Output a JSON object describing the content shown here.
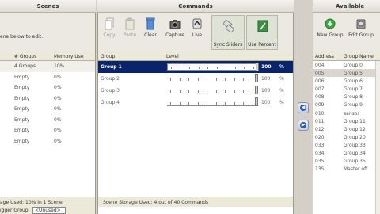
{
  "scenes": {
    "title": "Scenes",
    "hint": "ene below to edit.",
    "columns": [
      "# Groups",
      "Memory Use"
    ],
    "rows": [
      {
        "groups": "4 Groups",
        "memory": "10%",
        "selected": true
      },
      {
        "groups": "Empty",
        "memory": "0%",
        "selected": false
      },
      {
        "groups": "Empty",
        "memory": "0%",
        "selected": false
      },
      {
        "groups": "Empty",
        "memory": "0%",
        "selected": false
      },
      {
        "groups": "Empty",
        "memory": "0%",
        "selected": false
      },
      {
        "groups": "Empty",
        "memory": "0%",
        "selected": false
      },
      {
        "groups": "Empty",
        "memory": "0%",
        "selected": false
      },
      {
        "groups": "Empty",
        "memory": "0%",
        "selected": false
      }
    ],
    "storage": "age Used: 10% in 1 Scene",
    "trigger_label": "igger Group",
    "trigger_value": "<Unused>"
  },
  "commands": {
    "title": "Commands",
    "toolbar": {
      "copy": "Copy",
      "paste": "Paste",
      "clear": "Clear",
      "capture": "Capture",
      "live": "Live",
      "sync_sliders": "Sync Sliders",
      "use_percent": "Use Percent"
    },
    "columns": [
      "Group",
      "Level"
    ],
    "rows": [
      {
        "name": "Group 1",
        "level": "100",
        "unit": "%",
        "fraction": 1.0,
        "selected": true
      },
      {
        "name": "Group 2",
        "level": "100",
        "unit": "%",
        "fraction": 1.0,
        "selected": false
      },
      {
        "name": "Group 3",
        "level": "100",
        "unit": "%",
        "fraction": 1.0,
        "selected": false
      },
      {
        "name": "Group 4",
        "level": "100",
        "unit": "%",
        "fraction": 1.0,
        "selected": false
      }
    ],
    "storage": "Scene Storage Used: 4 out of 40 Commands"
  },
  "available": {
    "title": "Available Groups",
    "new_group": "New Group",
    "edit_group": "Edit Group",
    "columns": [
      "Address",
      "Group Name"
    ],
    "rows": [
      {
        "address": "004",
        "name": "Group 0",
        "selected": false
      },
      {
        "address": "005",
        "name": "Group 5",
        "selected": true
      },
      {
        "address": "006",
        "name": "Group 6",
        "selected": false
      },
      {
        "address": "007",
        "name": "Group 7",
        "selected": false
      },
      {
        "address": "008",
        "name": "Group 8",
        "selected": false
      },
      {
        "address": "009",
        "name": "Group 9",
        "selected": false
      },
      {
        "address": "010",
        "name": "sensor",
        "selected": false
      },
      {
        "address": "011",
        "name": "Group 11",
        "selected": false
      },
      {
        "address": "012",
        "name": "Group 12",
        "selected": false
      },
      {
        "address": "020",
        "name": "Group 20",
        "selected": false
      },
      {
        "address": "033",
        "name": "Group 33",
        "selected": false
      },
      {
        "address": "034",
        "name": "Group 34",
        "selected": false
      },
      {
        "address": "035",
        "name": "Group 35",
        "selected": false
      },
      {
        "address": "135",
        "name": "Master off",
        "selected": false
      }
    ]
  }
}
